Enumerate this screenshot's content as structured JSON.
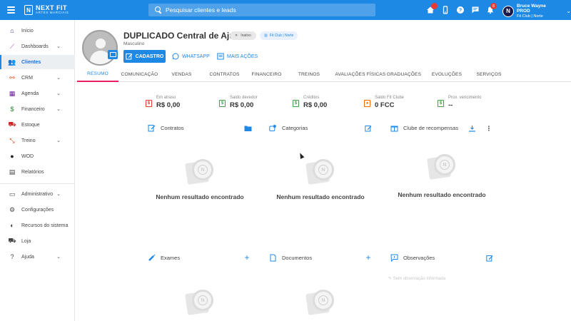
{
  "app": {
    "logo_mark": "N",
    "logo_line1": "NEXT FIT",
    "logo_line2": "ARTES MARCIAIS",
    "search_placeholder": "Pesquisar clientes e leads",
    "user_initial": "N",
    "user_name": "Bruce Wayne PROD",
    "user_unit": "Fit Club | Norte",
    "notification_count": "8"
  },
  "top_icons": [
    "home-icon",
    "mobile-icon",
    "help-icon",
    "chat-icon",
    "bell-icon"
  ],
  "sidebar": {
    "items": [
      {
        "label": "Início",
        "icon": "home-icon",
        "color": "#3f2a78"
      },
      {
        "label": "Dashboards",
        "icon": "chart-icon",
        "color": "#8e44ad",
        "expandable": true
      },
      {
        "label": "Clientes",
        "icon": "users-icon",
        "color": "#1e88e5",
        "active": true
      },
      {
        "label": "CRM",
        "icon": "crm-icon",
        "color": "#e64a19",
        "expandable": true
      },
      {
        "label": "Agenda",
        "icon": "calendar-icon",
        "color": "#6a1b9a",
        "expandable": true
      },
      {
        "label": "Financeiro",
        "icon": "money-icon",
        "color": "#2e7d32",
        "expandable": true
      },
      {
        "label": "Estoque",
        "icon": "cart-icon",
        "color": "#c62828"
      },
      {
        "label": "Treino",
        "icon": "dumbbell-icon",
        "color": "#d84315",
        "expandable": true
      },
      {
        "label": "WOD",
        "icon": "kettlebell-icon",
        "color": "#212121"
      },
      {
        "label": "Relatórios",
        "icon": "report-icon",
        "color": "#424242"
      },
      {
        "label": "Administrativo",
        "icon": "id-card-icon",
        "color": "#424242",
        "expandable": true
      },
      {
        "label": "Configurações",
        "icon": "gear-icon",
        "color": "#424242"
      },
      {
        "label": "Recursos do sistema",
        "icon": "toggle-icon",
        "color": "#424242"
      },
      {
        "label": "Loja",
        "icon": "cart-icon",
        "color": "#424242"
      },
      {
        "label": "Ajuda",
        "icon": "help-icon",
        "color": "#424242",
        "expandable": true
      }
    ]
  },
  "profile": {
    "name": "DUPLICADO Central de Ajuda",
    "status": "Inativo",
    "unit": "Fit Club | Norte",
    "gender": "Masculino",
    "btn_cadastro": "CADASTRO",
    "btn_whatsapp": "WHATSAPP",
    "btn_more": "MAIS AÇÕES"
  },
  "tabs": [
    "RESUMO",
    "COMUNICAÇÃO",
    "VENDAS",
    "CONTRATOS",
    "FINANCEIRO",
    "TREINOS",
    "AVALIAÇÕES FÍSICAS",
    "GRADUAÇÕES",
    "EVOLUÇÕES",
    "SERVIÇOS"
  ],
  "stats": [
    {
      "label": "Em atraso",
      "value": "R$ 0,00",
      "color": "#e53935"
    },
    {
      "label": "Saldo devedor",
      "value": "R$ 0,00",
      "color": "#43a047"
    },
    {
      "label": "Créditos",
      "value": "R$ 0,00",
      "color": "#43a047"
    },
    {
      "label": "Saldo Fit Clube",
      "value": "0 FCC",
      "color": "#ef6c00"
    },
    {
      "label": "Prox. vencimento",
      "value": "--",
      "color": "#43a047"
    }
  ],
  "sections": {
    "contratos": "Contratos",
    "categorias": "Categorias",
    "clube": "Clube de recompensas",
    "exames": "Exames",
    "documentos": "Documentos",
    "observacoes": "Observações"
  },
  "empty_text": "Nenhum resultado encontrado",
  "faint_text": "Sem observação informada"
}
